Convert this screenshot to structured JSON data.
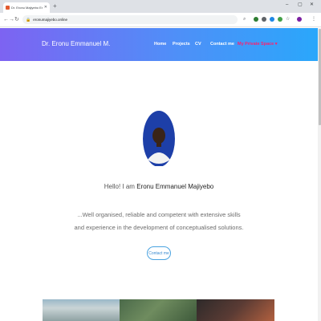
{
  "browser": {
    "tab_title": "Dr. Eronu Majiyebo Emm...",
    "tab_close_icon": "close-icon",
    "new_tab_icon": "plus-icon",
    "address": "eronumajiyebo.online",
    "window_controls": [
      "minimize-icon",
      "restore-icon",
      "close-icon"
    ],
    "extensions": [
      "search-icon",
      "extension-icon",
      "extension-icon",
      "extension-icon",
      "extension-icon",
      "star-icon",
      "profile-icon",
      "menu-icon"
    ]
  },
  "site": {
    "brand": "Dr. Eronu Emmanuel M.",
    "nav": [
      "Home",
      "Projects",
      "CV",
      "Contact me",
      "My Private Space ▾"
    ],
    "header_gradient": [
      "#7d63f2",
      "#2aa7fb"
    ],
    "private_color": "#ff1f6e"
  },
  "hero": {
    "greeting_prefix": "Hello! I am ",
    "greeting_name": "Eronu Emmanuel Majiyebo",
    "tagline": "...Well organised, reliable and competent with extensive skills and experience in the development of conceptualised solutions.",
    "contact_button": "Contact me"
  }
}
